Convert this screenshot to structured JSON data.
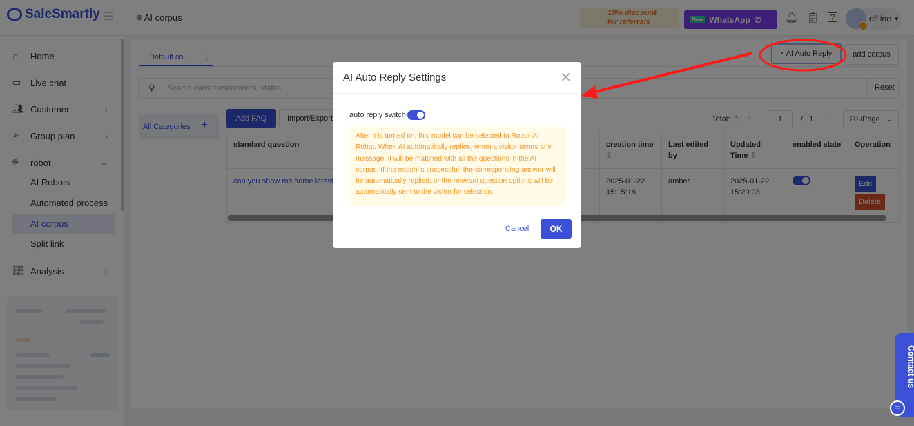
{
  "header": {
    "brand": "SaleSmartly",
    "title": "AI corpus",
    "promo": "10% discount\nfor referrals",
    "promo_line1": "10% discount",
    "promo_line2": "for referrals",
    "whatsapp_badge": "New",
    "whatsapp_label": "WhatsApp",
    "user_status": "offline"
  },
  "sidebar": {
    "items": [
      {
        "label": "Home"
      },
      {
        "label": "Live chat"
      },
      {
        "label": "Customer"
      },
      {
        "label": "Group plan"
      },
      {
        "label": "robot"
      },
      {
        "label": "Analysis"
      }
    ],
    "robot_sub": [
      {
        "label": "AI Robots"
      },
      {
        "label": "Automated process"
      },
      {
        "label": "AI corpus"
      },
      {
        "label": "Split link"
      }
    ]
  },
  "main": {
    "tab": "Default co...",
    "tab_menu": "⋮",
    "ai_auto_reply": "AI Auto Reply",
    "add_corpus": "add corpus",
    "search_placeholder": "Search questions/answers, status",
    "reset": "Reset",
    "all_categories": "All Categories",
    "add_cat": "+",
    "add_faq": "Add FAQ",
    "import_export": "Import/Export",
    "pager": {
      "total_label": "Total:",
      "total": "1",
      "page": "1",
      "sep": "/",
      "pages": "1",
      "page_size": "20 /Page"
    },
    "columns": [
      "standard question",
      "creation time",
      "Last edited by",
      "Updated Time",
      "enabled state",
      "Operation"
    ],
    "rows": [
      {
        "question": "can you show me some latest",
        "created_date": "2025-01-22",
        "created_time": "15:15:18",
        "editor": "amber",
        "updated_date": "2025-01-22",
        "updated_time": "15:20:03",
        "enabled": true,
        "edit": "Edit",
        "delete": "Delete"
      }
    ]
  },
  "modal": {
    "title": "AI Auto Reply Settings",
    "switch_label": "auto reply switch",
    "switch_on": true,
    "note": "After it is turned on, this model can be selected in Robot-AI Robot. When AI automatically replies, when a visitor sends any message, it will be matched with all the questions in the AI corpus. If the match is successful, the corresponding answer will be automatically replied, or the relevant question options will be automatically sent to the visitor for selection.",
    "cancel": "Cancel",
    "ok": "OK"
  },
  "contact": {
    "label": "Contact us"
  },
  "colors": {
    "accent": "#3b50d6",
    "warning_text": "#f5962e",
    "annotation": "#ff1a1a"
  }
}
